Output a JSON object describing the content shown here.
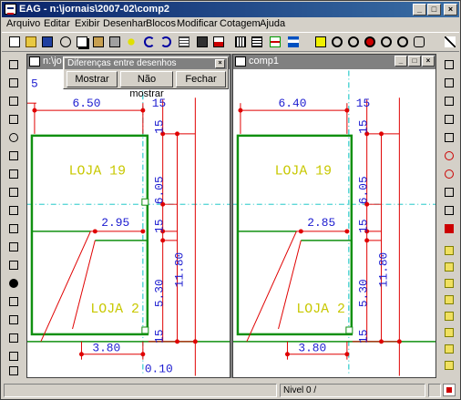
{
  "window": {
    "title": "EAG - n:\\jornais\\2007-02\\comp2",
    "btn_min": "_",
    "btn_max": "□",
    "btn_close": "×"
  },
  "menu": [
    "Arquivo",
    "Editar",
    "Exibir",
    "Desenhar",
    "Blocos",
    "Modificar",
    "Cotagem",
    "Ajuda"
  ],
  "child_left": {
    "title": "n:\\jo"
  },
  "child_right": {
    "title": "comp1"
  },
  "dialog": {
    "title": "Diferenças entre desenhos",
    "btn_show": "Mostrar",
    "btn_hide": "Não mostrar",
    "btn_close": "Fechar"
  },
  "drawing_left": {
    "dim_top": "6.50",
    "dim_mid": "2.95",
    "dim_bottom": "3.80",
    "dim_bottom2": "0.10",
    "vdim_1": "6.05",
    "vdim_2": "11.80",
    "vdim_3": "5.30",
    "vdim_4": "15",
    "label_loja_1": "LOJA 19",
    "label_loja_2": "LOJA 2",
    "edge_5": "5"
  },
  "drawing_right": {
    "dim_top": "6.40",
    "dim_mid": "2.85",
    "dim_bottom": "3.80",
    "vdim_1": "6.05",
    "vdim_2": "11.80",
    "vdim_3": "5.30",
    "vdim_4": "15",
    "label_loja_1": "LOJA 19",
    "label_loja_2": "LOJA 2"
  },
  "status": {
    "level": "Nivel 0 /"
  },
  "colors": {
    "dim_text": "#1c1cd0",
    "dim_line": "#e00000",
    "wall": "#109010",
    "axis": "#00c0c0",
    "room_label": "#c8c800"
  }
}
